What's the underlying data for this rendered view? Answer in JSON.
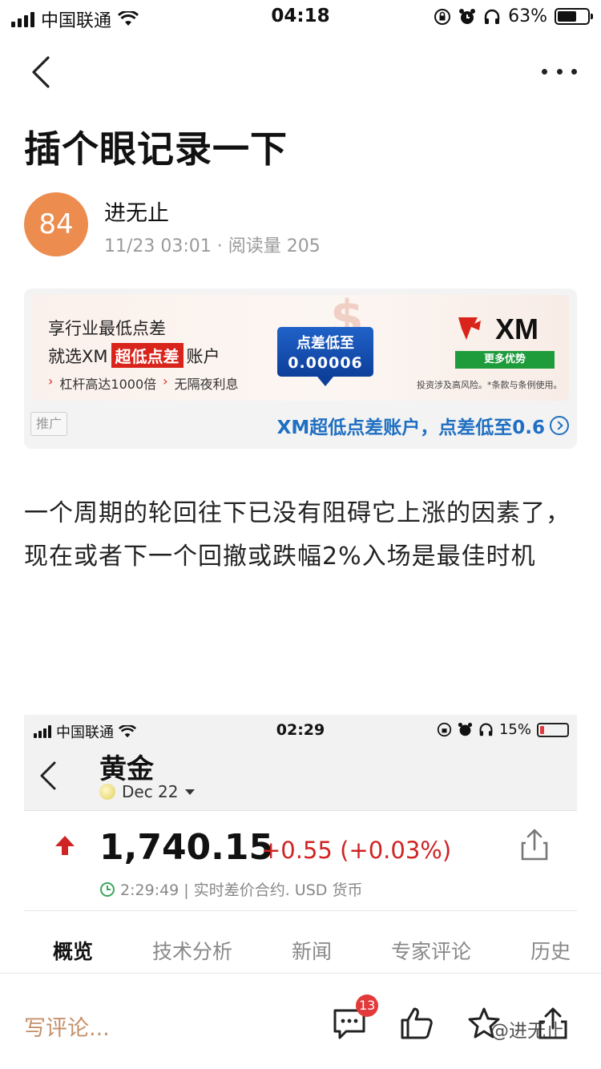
{
  "status_bar": {
    "carrier": "中国联通",
    "time": "04:18",
    "battery": "63%",
    "battery_level": 0.63
  },
  "nav": {
    "back_icon": "chevron-left-icon",
    "more_icon": "more-dots-icon"
  },
  "post": {
    "title": "插个眼记录一下",
    "avatar_text": "84",
    "author": "进无止",
    "meta": "11/23 03:01 · 阅读量 205",
    "body": "一个周期的轮回往下已没有阻碍它上涨的因素了，现在或者下一个回撤或跌幅2%入场是最佳时机"
  },
  "ad": {
    "line1": "享行业最低点差",
    "line2_prefix": "就选XM",
    "line2_badge": "超低点差",
    "line2_suffix": "账户",
    "feature1": "杠杆高达1000倍",
    "feature2": "无隔夜利息",
    "spread_label": "点差低至",
    "spread_value": "0.00006",
    "brand": "XM",
    "brand_button": "更多优势",
    "disclaimer": "投资涉及高风险。*条款与条例使用。",
    "tag": "推广",
    "cta": "XM超低点差账户，点差低至0.6"
  },
  "screenshot": {
    "carrier": "中国联通",
    "time": "02:29",
    "battery": "15%",
    "battery_level": 0.15,
    "title": "黄金",
    "contract": "Dec 22",
    "price": "1,740.15",
    "change": "+0.55 (+0.03%)",
    "price_meta": "2:29:49 | 实时差价合约. USD 货币",
    "tabs": [
      "概览",
      "技术分析",
      "新闻",
      "专家评论",
      "历史"
    ]
  },
  "bottom_bar": {
    "comment_placeholder": "写评论...",
    "comment_count": "13",
    "watermark": "@进无止"
  },
  "colors": {
    "accent": "#ec8c4f",
    "ad_blue": "#1f6fc2",
    "price_red": "#d02323",
    "xm_green": "#1e9c3c"
  }
}
